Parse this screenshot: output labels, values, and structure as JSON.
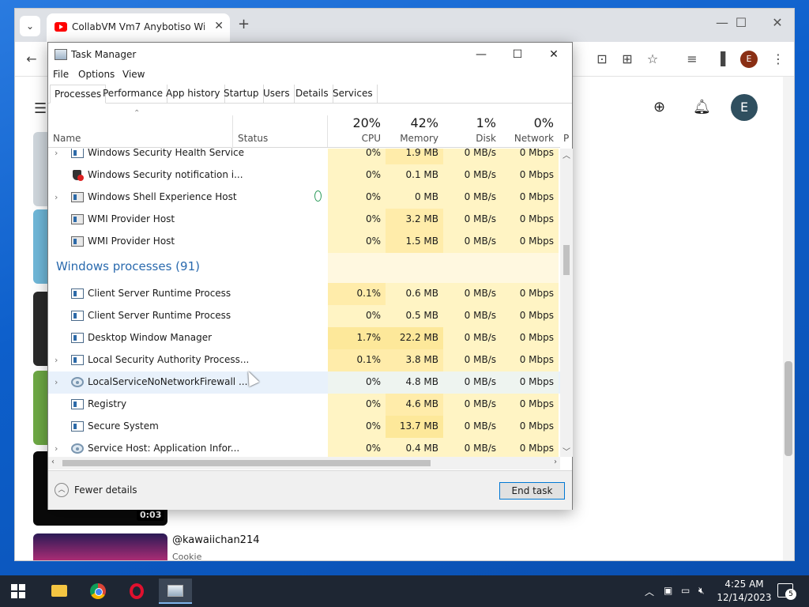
{
  "browser": {
    "tab_title": "CollabVM Vm7 Anybotiso Wind",
    "profile_initial": "E",
    "tab_close": "✕",
    "new_tab": "+",
    "minimize": "—",
    "restore": "☐",
    "close": "✕"
  },
  "youtube": {
    "avatar_initial": "E",
    "duration": "0:03",
    "channel": "@kawaiichan214",
    "subtitle": "Cookie"
  },
  "task_manager": {
    "title": "Task Manager",
    "menu": [
      "File",
      "Options",
      "View"
    ],
    "tabs": [
      "Processes",
      "Performance",
      "App history",
      "Startup",
      "Users",
      "Details",
      "Services"
    ],
    "columns": {
      "name": "Name",
      "status": "Status",
      "cpu": {
        "pct": "20%",
        "label": "CPU"
      },
      "memory": {
        "pct": "42%",
        "label": "Memory"
      },
      "disk": {
        "pct": "1%",
        "label": "Disk"
      },
      "network": {
        "pct": "0%",
        "label": "Network"
      },
      "power_partial": "P"
    },
    "rows_top": [
      {
        "name": "Windows Security Health Service",
        "cpu": "0%",
        "mem": "1.9 MB",
        "disk": "0 MB/s",
        "net": "0 Mbps"
      },
      {
        "name": "Windows Security notification i...",
        "cpu": "0%",
        "mem": "0.1 MB",
        "disk": "0 MB/s",
        "net": "0 Mbps"
      },
      {
        "name": "Windows Shell Experience Host",
        "cpu": "0%",
        "mem": "0 MB",
        "disk": "0 MB/s",
        "net": "0 Mbps"
      },
      {
        "name": "WMI Provider Host",
        "cpu": "0%",
        "mem": "3.2 MB",
        "disk": "0 MB/s",
        "net": "0 Mbps"
      },
      {
        "name": "WMI Provider Host",
        "cpu": "0%",
        "mem": "1.5 MB",
        "disk": "0 MB/s",
        "net": "0 Mbps"
      }
    ],
    "group_title": "Windows processes (91)",
    "rows_windows": [
      {
        "name": "Client Server Runtime Process",
        "cpu": "0.1%",
        "mem": "0.6 MB",
        "disk": "0 MB/s",
        "net": "0 Mbps"
      },
      {
        "name": "Client Server Runtime Process",
        "cpu": "0%",
        "mem": "0.5 MB",
        "disk": "0 MB/s",
        "net": "0 Mbps"
      },
      {
        "name": "Desktop Window Manager",
        "cpu": "1.7%",
        "mem": "22.2 MB",
        "disk": "0 MB/s",
        "net": "0 Mbps"
      },
      {
        "name": "Local Security Authority Process...",
        "cpu": "0.1%",
        "mem": "3.8 MB",
        "disk": "0 MB/s",
        "net": "0 Mbps"
      },
      {
        "name": "LocalServiceNoNetworkFirewall ...",
        "cpu": "0%",
        "mem": "4.8 MB",
        "disk": "0 MB/s",
        "net": "0 Mbps"
      },
      {
        "name": "Registry",
        "cpu": "0%",
        "mem": "4.6 MB",
        "disk": "0 MB/s",
        "net": "0 Mbps"
      },
      {
        "name": "Secure System",
        "cpu": "0%",
        "mem": "13.7 MB",
        "disk": "0 MB/s",
        "net": "0 Mbps"
      },
      {
        "name": "Service Host: Application Infor...",
        "cpu": "0%",
        "mem": "0.4 MB",
        "disk": "0 MB/s",
        "net": "0 Mbps"
      }
    ],
    "fewer_details": "Fewer details",
    "end_task": "End task"
  },
  "taskbar": {
    "time": "4:25 AM",
    "date": "12/14/2023",
    "notifications": "5"
  }
}
